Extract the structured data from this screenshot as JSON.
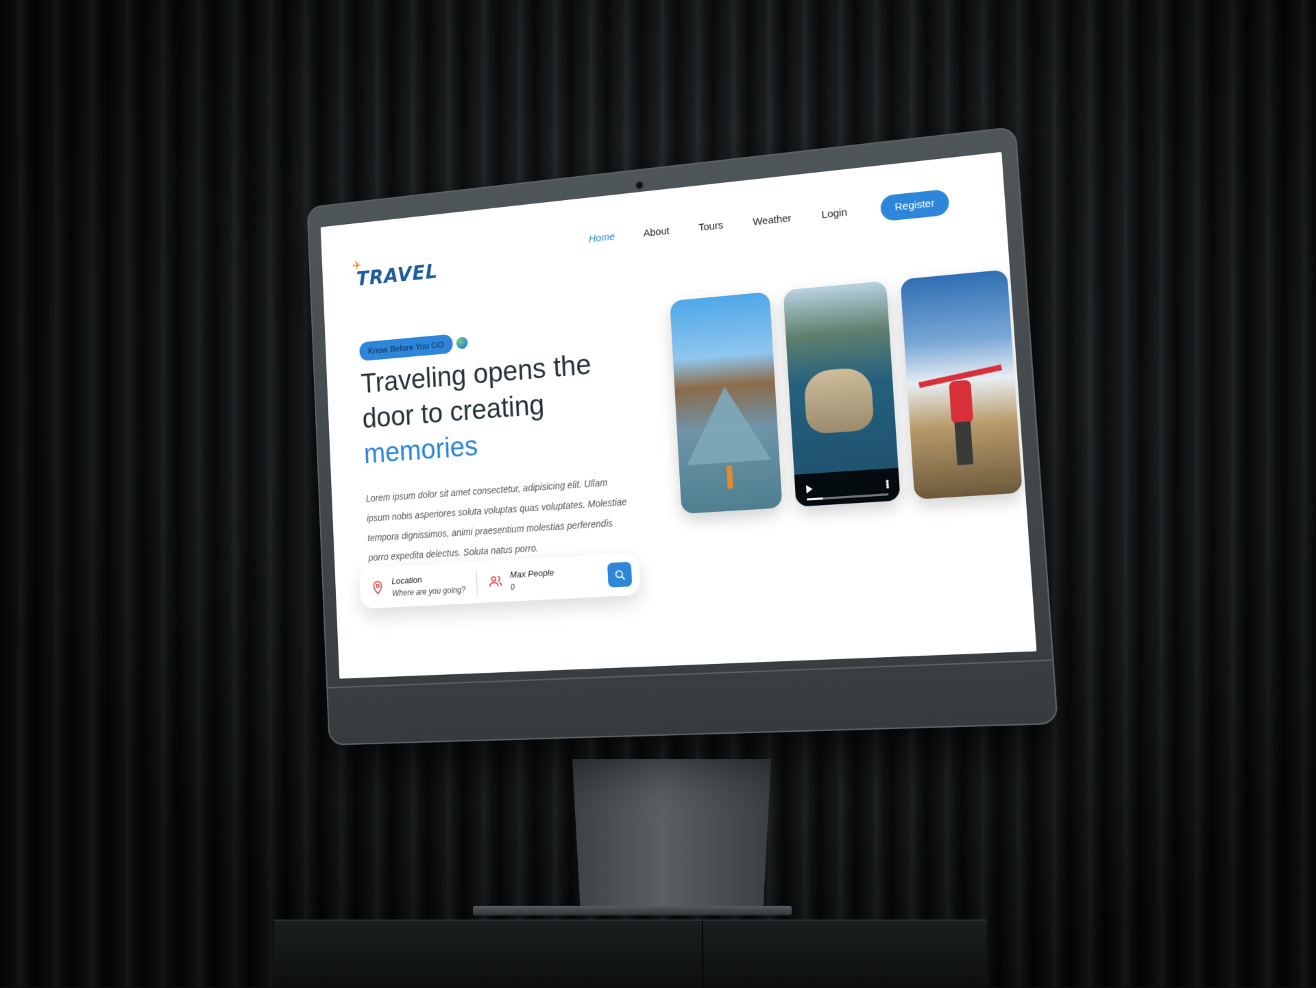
{
  "brand": {
    "logo_text": "TRAVEL"
  },
  "nav": {
    "items": [
      {
        "label": "Home",
        "active": true
      },
      {
        "label": "About",
        "active": false
      },
      {
        "label": "Tours",
        "active": false
      },
      {
        "label": "Weather",
        "active": false
      },
      {
        "label": "Login",
        "active": false
      }
    ],
    "register_label": "Register"
  },
  "hero": {
    "tag": "Know Before You GO",
    "headline_line1": "Traveling opens the door to creating",
    "headline_accent": "memories",
    "description": "Lorem ipsum dolor sit amet consectetur, adipisicing elit. Ullam ipsum nobis asperiores soluta voluptas quas voluptates. Molestiae tempora dignissimos, animi praesentium molestias perferendis porro expedita delectus. Soluta natus porro."
  },
  "search": {
    "location_label": "Location",
    "location_placeholder": "Where are you going?",
    "people_label": "Max People",
    "people_value": "0"
  },
  "cards": [
    {
      "name": "louvre-photo"
    },
    {
      "name": "coast-video",
      "video_progress": 0.2
    },
    {
      "name": "hiker-photo"
    }
  ],
  "colors": {
    "accent": "#2d86da",
    "logo_blue": "#1f5c9e",
    "logo_orange": "#f08a1c",
    "icon_red": "#e04a4a"
  },
  "icons": [
    "globe-icon",
    "pin-icon",
    "people-icon",
    "search-icon",
    "play-icon",
    "more-icon"
  ]
}
